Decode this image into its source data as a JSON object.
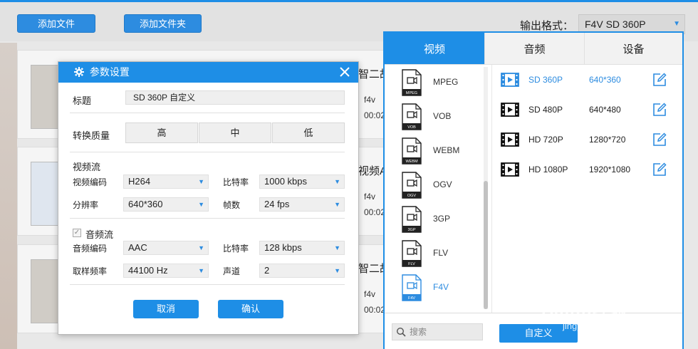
{
  "toolbar": {
    "add_file": "添加文件",
    "add_folder": "添加文件夹",
    "output_format_label": "输出格式：",
    "output_format_value": "F4V  SD 360P"
  },
  "file_list": [
    {
      "name": "智二故",
      "format": "f4v",
      "duration": "00:02"
    },
    {
      "name": "视频A",
      "format": "f4v",
      "duration": "00:02"
    },
    {
      "name": "智二故",
      "format": "f4v",
      "duration": "00:02"
    }
  ],
  "dialog": {
    "title": "参数设置",
    "title_label": "标题",
    "title_value": "SD 360P 自定义",
    "quality_label": "转换质量",
    "quality_options": [
      "高",
      "中",
      "低"
    ],
    "video_section": "视频流",
    "video_codec_label": "视频编码",
    "video_codec": "H264",
    "video_bitrate_label": "比特率",
    "video_bitrate": "1000 kbps",
    "resolution_label": "分辨率",
    "resolution": "640*360",
    "fps_label": "帧数",
    "fps": "24 fps",
    "audio_section": "音频流",
    "audio_codec_label": "音频编码",
    "audio_codec": "AAC",
    "audio_bitrate_label": "比特率",
    "audio_bitrate": "128 kbps",
    "sample_rate_label": "取样频率",
    "sample_rate": "44100 Hz",
    "channel_label": "声道",
    "channel": "2",
    "cancel": "取消",
    "confirm": "确认"
  },
  "format_panel": {
    "tabs": [
      "视频",
      "音频",
      "设备"
    ],
    "formats": [
      {
        "name": "MPEG",
        "tag": "MPEG"
      },
      {
        "name": "VOB",
        "tag": "VOB"
      },
      {
        "name": "WEBM",
        "tag": "WEBM"
      },
      {
        "name": "OGV",
        "tag": "OGV"
      },
      {
        "name": "3GP",
        "tag": "3GP"
      },
      {
        "name": "FLV",
        "tag": "FLV"
      },
      {
        "name": "F4V",
        "tag": "F4V"
      }
    ],
    "presets": [
      {
        "name": "SD 360P",
        "res": "640*360"
      },
      {
        "name": "SD 480P",
        "res": "640*480"
      },
      {
        "name": "HD 720P",
        "res": "1280*720"
      },
      {
        "name": "HD 1080P",
        "res": "1920*1080"
      }
    ],
    "search_placeholder": "搜索",
    "custom_button": "自定义"
  },
  "watermark": {
    "text": "Baidu经验",
    "url": "jingyan.baidu.com"
  },
  "colors": {
    "accent": "#1e8ee6",
    "selected_text": "#2d8ce0"
  }
}
